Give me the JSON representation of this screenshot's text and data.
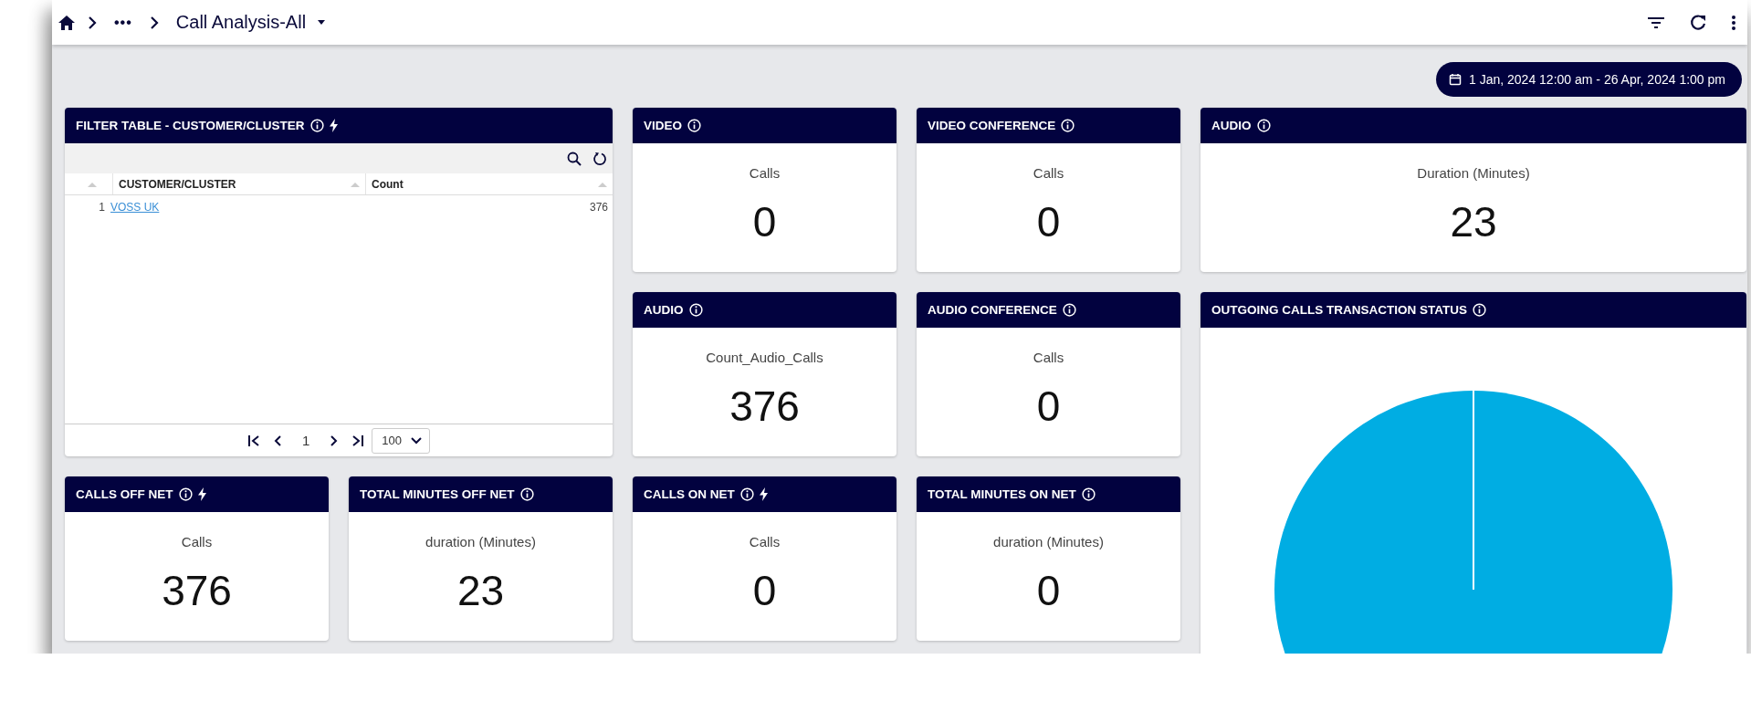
{
  "breadcrumb": {
    "title": "Call Analysis-All",
    "ellipsis": "•••"
  },
  "date_range": "1 Jan, 2024 12:00 am - 26 Apr, 2024 1:00 pm",
  "panels": [
    {
      "kind": "table",
      "title": "FILTER TABLE - CUSTOMER/CLUSTER",
      "flash": true,
      "columns": [
        "CUSTOMER/CLUSTER",
        "Count"
      ],
      "rows": [
        {
          "index": "1",
          "name": "VOSS UK",
          "count": "376"
        }
      ],
      "pagination": {
        "page": "1",
        "page_size": "100"
      }
    },
    {
      "kind": "metric",
      "title": "VIDEO",
      "flash": false,
      "label": "Calls",
      "value": "0"
    },
    {
      "kind": "metric",
      "title": "VIDEO CONFERENCE",
      "flash": false,
      "label": "Calls",
      "value": "0"
    },
    {
      "kind": "metric",
      "title": "AUDIO",
      "flash": false,
      "label": "Duration (Minutes)",
      "value": "23"
    },
    {
      "kind": "metric",
      "title": "AUDIO",
      "flash": false,
      "label": "Count_Audio_Calls",
      "value": "376"
    },
    {
      "kind": "metric",
      "title": "AUDIO CONFERENCE",
      "flash": false,
      "label": "Calls",
      "value": "0"
    },
    {
      "kind": "pie",
      "title": "OUTGOING CALLS TRANSACTION STATUS",
      "flash": false
    },
    {
      "kind": "metric",
      "title": "CALLS OFF NET",
      "flash": true,
      "label": "Calls",
      "value": "376"
    },
    {
      "kind": "metric",
      "title": "TOTAL MINUTES OFF NET",
      "flash": false,
      "label": "duration (Minutes)",
      "value": "23"
    },
    {
      "kind": "metric",
      "title": "CALLS ON NET",
      "flash": true,
      "label": "Calls",
      "value": "0"
    },
    {
      "kind": "metric",
      "title": "TOTAL MINUTES ON NET",
      "flash": false,
      "label": "duration (Minutes)",
      "value": "0"
    }
  ]
}
